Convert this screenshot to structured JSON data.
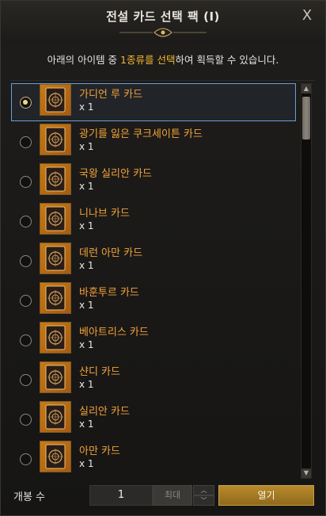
{
  "dialog": {
    "title": "전설 카드 선택 팩 (I)",
    "close_label": "X",
    "notice_prefix": "아래의 아이템 중 ",
    "notice_highlight": "1종류를 선택",
    "notice_suffix": "하여 획득할 수 있습니다."
  },
  "items": [
    {
      "name": "가디언 루 카드",
      "qty": "x 1",
      "selected": true
    },
    {
      "name": "광기를 잃은 쿠크세이튼 카드",
      "qty": "x 1",
      "selected": false
    },
    {
      "name": "국왕 실리안 카드",
      "qty": "x 1",
      "selected": false
    },
    {
      "name": "니나브 카드",
      "qty": "x 1",
      "selected": false
    },
    {
      "name": "데런 아만 카드",
      "qty": "x 1",
      "selected": false
    },
    {
      "name": "바훈투르 카드",
      "qty": "x 1",
      "selected": false
    },
    {
      "name": "베아트리스 카드",
      "qty": "x 1",
      "selected": false
    },
    {
      "name": "샨디 카드",
      "qty": "x 1",
      "selected": false
    },
    {
      "name": "실리안 카드",
      "qty": "x 1",
      "selected": false
    },
    {
      "name": "아만 카드",
      "qty": "x 1",
      "selected": false
    }
  ],
  "footer": {
    "count_label": "개봉 수",
    "count_value": "1",
    "max_label": "최대",
    "open_label": "열기"
  },
  "colors": {
    "accent_gold": "#f2b631",
    "item_name": "#f2a33a",
    "selection_border": "#6a9ed6"
  },
  "icons": [
    "close-icon",
    "ornament-icon",
    "card-icon",
    "scroll-up-icon",
    "scroll-down-icon",
    "chevron-up-icon",
    "chevron-down-icon"
  ]
}
